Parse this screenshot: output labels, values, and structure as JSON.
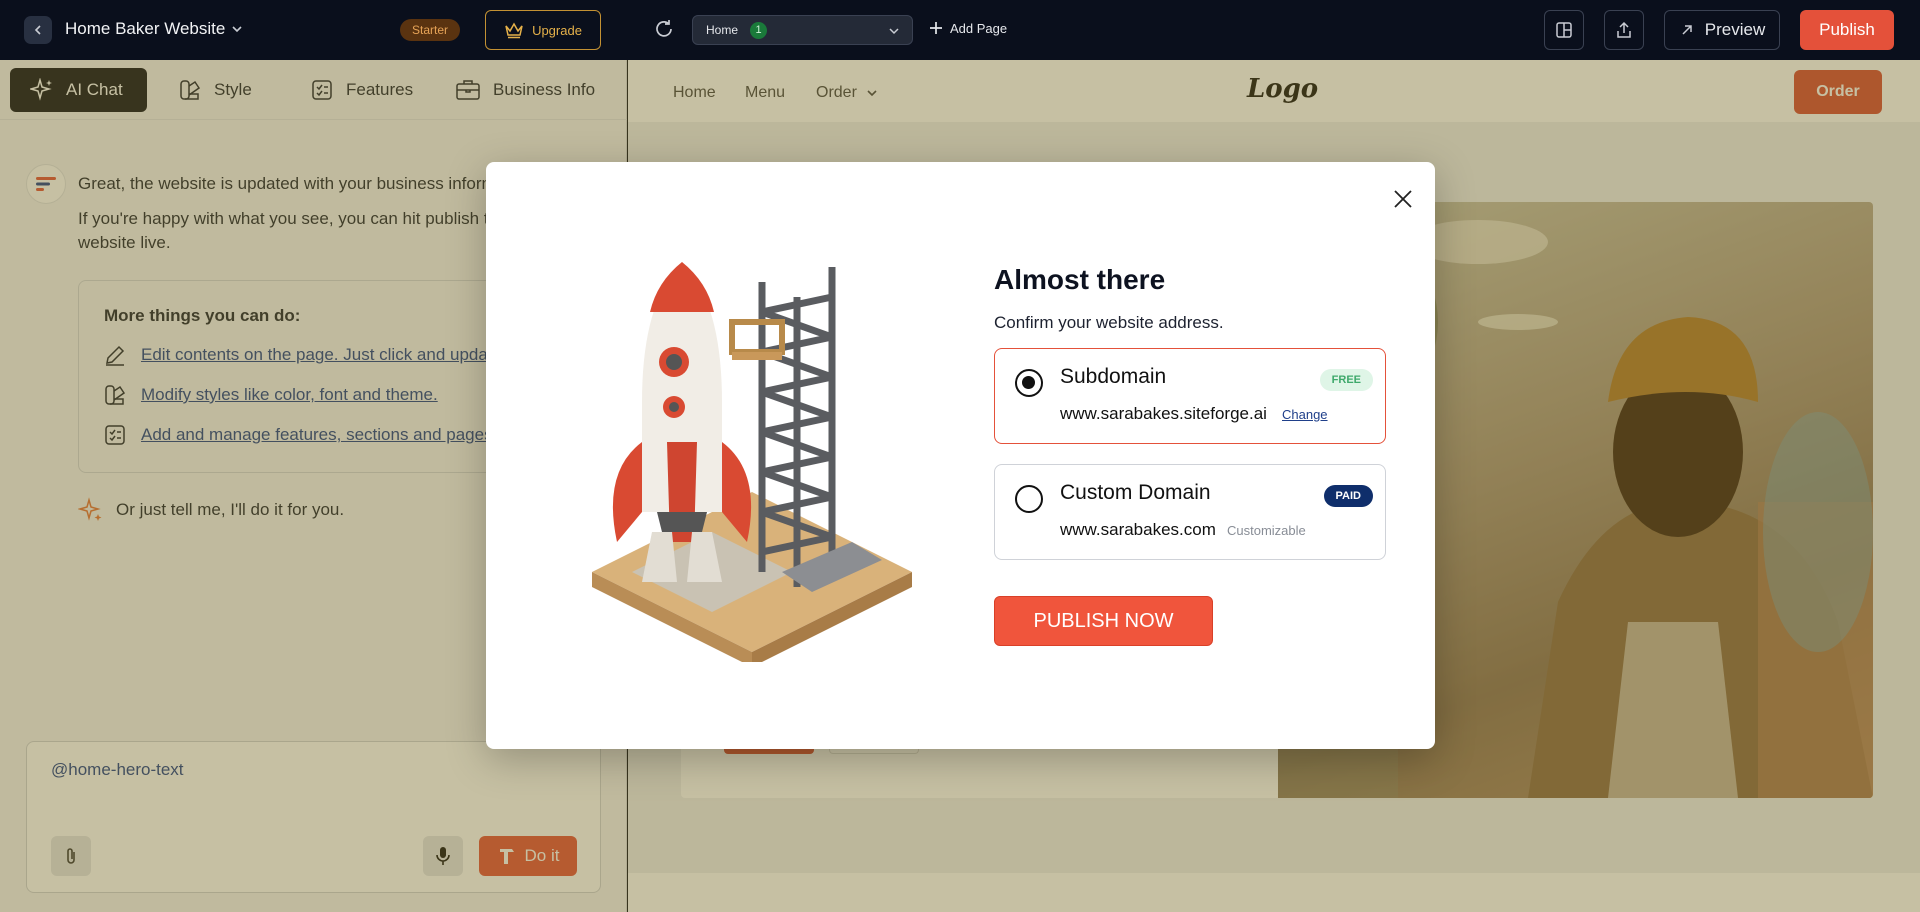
{
  "topbar": {
    "site_name": "Home Baker Website",
    "plan_badge": "Starter",
    "upgrade_label": "Upgrade",
    "page_selector": {
      "label": "Home",
      "count": "1"
    },
    "add_page_label": "Add Page",
    "preview_label": "Preview",
    "publish_label": "Publish"
  },
  "left_panel": {
    "tabs": [
      {
        "label": "AI Chat",
        "icon": "sparkle-icon",
        "active": true
      },
      {
        "label": "Style",
        "icon": "palette-icon"
      },
      {
        "label": "Features",
        "icon": "checklist-icon"
      },
      {
        "label": "Business Info",
        "icon": "briefcase-icon"
      }
    ],
    "chat": {
      "message_line1": "Great, the website is updated with your business inform",
      "message_line2": "If you're happy with what you see, you can hit publish to",
      "message_line3": "website live.",
      "more_title": "More things you can do:",
      "more_items": [
        {
          "label": "Edit contents on the page. Just click and updat",
          "icon": "pencil-icon"
        },
        {
          "label": "Modify styles like color, font and theme.",
          "icon": "palette-icon"
        },
        {
          "label": "Add and manage features, sections and pages",
          "icon": "checklist-icon"
        }
      ],
      "tell_me": "Or just tell me, I'll do it for you."
    },
    "composer": {
      "value": "@home-hero-text",
      "submit_label": "Do it"
    }
  },
  "site_preview": {
    "nav": [
      "Home",
      "Menu",
      "Order"
    ],
    "logo": "Logo",
    "order_button": "Order"
  },
  "modal": {
    "title": "Almost there",
    "subtitle": "Confirm your website address.",
    "options": [
      {
        "title": "Subdomain",
        "badge": "FREE",
        "url": "www.sarabakes.siteforge.ai",
        "action": "Change",
        "selected": true
      },
      {
        "title": "Custom Domain",
        "badge": "PAID",
        "url": "www.sarabakes.com",
        "note": "Customizable",
        "selected": false
      }
    ],
    "cta_label": "PUBLISH NOW"
  },
  "colors": {
    "accent": "#e4513a",
    "topbar_bg": "#0a0f1c",
    "link": "#1f3f8a",
    "paid_badge": "#0f2e6b",
    "free_badge_text": "#3fa96c"
  }
}
